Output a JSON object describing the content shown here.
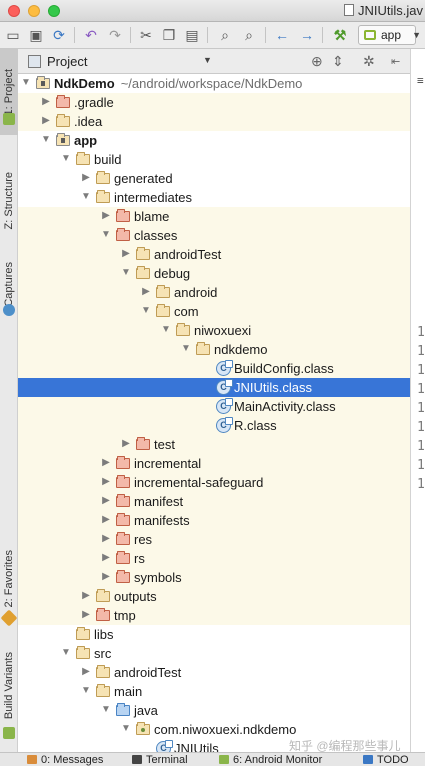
{
  "window": {
    "title": "JNIUtils.jav",
    "run_config": "app"
  },
  "toolbar_icons": [
    "open-folder-icon",
    "save-icon",
    "sync-icon",
    "undo-icon",
    "redo-icon",
    "cut-icon",
    "copy-icon",
    "paste-icon",
    "find-icon",
    "replace-icon",
    "back-icon",
    "forward-icon",
    "build-hammer-icon"
  ],
  "left_tabs": {
    "project": "1: Project",
    "structure": "Z: Structure",
    "captures": "Captures",
    "favorites": "2: Favorites",
    "build_variants": "Build Variants"
  },
  "panel": {
    "view_label": "Project"
  },
  "tree": [
    {
      "label": "NdkDemo",
      "path": "~/android/workspace/NdkDemo",
      "depth": 0,
      "arrow": "expanded",
      "icon": "module",
      "bold": true,
      "band": false
    },
    {
      "label": ".gradle",
      "depth": 1,
      "arrow": "collapsed",
      "icon": "excluded",
      "band": true
    },
    {
      "label": ".idea",
      "depth": 1,
      "arrow": "collapsed",
      "icon": "plain",
      "band": true
    },
    {
      "label": "app",
      "depth": 1,
      "arrow": "expanded",
      "icon": "module",
      "bold": true,
      "band": false
    },
    {
      "label": "build",
      "depth": 2,
      "arrow": "expanded",
      "icon": "plain",
      "band": false
    },
    {
      "label": "generated",
      "depth": 3,
      "arrow": "collapsed",
      "icon": "plain",
      "band": false
    },
    {
      "label": "intermediates",
      "depth": 3,
      "arrow": "expanded",
      "icon": "plain",
      "band": false
    },
    {
      "label": "blame",
      "depth": 4,
      "arrow": "collapsed",
      "icon": "excluded",
      "band": true
    },
    {
      "label": "classes",
      "depth": 4,
      "arrow": "expanded",
      "icon": "excluded",
      "band": true
    },
    {
      "label": "androidTest",
      "depth": 5,
      "arrow": "collapsed",
      "icon": "plain",
      "band": true
    },
    {
      "label": "debug",
      "depth": 5,
      "arrow": "expanded",
      "icon": "plain",
      "band": true
    },
    {
      "label": "android",
      "depth": 6,
      "arrow": "collapsed",
      "icon": "plain",
      "band": true
    },
    {
      "label": "com",
      "depth": 6,
      "arrow": "expanded",
      "icon": "plain",
      "band": true
    },
    {
      "label": "niwoxuexi",
      "depth": 7,
      "arrow": "expanded",
      "icon": "plain",
      "band": true
    },
    {
      "label": "ndkdemo",
      "depth": 8,
      "arrow": "expanded",
      "icon": "plain",
      "band": true
    },
    {
      "label": "BuildConfig.class",
      "depth": 9,
      "arrow": "none",
      "icon": "class",
      "band": true
    },
    {
      "label": "JNIUtils.class",
      "depth": 9,
      "arrow": "none",
      "icon": "class",
      "selected": true
    },
    {
      "label": "MainActivity.class",
      "depth": 9,
      "arrow": "none",
      "icon": "class",
      "band": true
    },
    {
      "label": "R.class",
      "depth": 9,
      "arrow": "none",
      "icon": "class",
      "band": true
    },
    {
      "label": "test",
      "depth": 5,
      "arrow": "collapsed",
      "icon": "excluded",
      "band": true
    },
    {
      "label": "incremental",
      "depth": 4,
      "arrow": "collapsed",
      "icon": "excluded",
      "band": true
    },
    {
      "label": "incremental-safeguard",
      "depth": 4,
      "arrow": "collapsed",
      "icon": "excluded",
      "band": true
    },
    {
      "label": "manifest",
      "depth": 4,
      "arrow": "collapsed",
      "icon": "excluded",
      "band": true
    },
    {
      "label": "manifests",
      "depth": 4,
      "arrow": "collapsed",
      "icon": "excluded",
      "band": true
    },
    {
      "label": "res",
      "depth": 4,
      "arrow": "collapsed",
      "icon": "excluded",
      "band": true
    },
    {
      "label": "rs",
      "depth": 4,
      "arrow": "collapsed",
      "icon": "excluded",
      "band": true
    },
    {
      "label": "symbols",
      "depth": 4,
      "arrow": "collapsed",
      "icon": "excluded",
      "band": true
    },
    {
      "label": "outputs",
      "depth": 3,
      "arrow": "collapsed",
      "icon": "plain",
      "band": true
    },
    {
      "label": "tmp",
      "depth": 3,
      "arrow": "collapsed",
      "icon": "excluded",
      "band": true
    },
    {
      "label": "libs",
      "depth": 2,
      "arrow": "none",
      "icon": "plain",
      "band": false
    },
    {
      "label": "src",
      "depth": 2,
      "arrow": "expanded",
      "icon": "plain",
      "band": false
    },
    {
      "label": "androidTest",
      "depth": 3,
      "arrow": "collapsed",
      "icon": "plain",
      "band": false
    },
    {
      "label": "main",
      "depth": 3,
      "arrow": "expanded",
      "icon": "plain",
      "band": false
    },
    {
      "label": "java",
      "depth": 4,
      "arrow": "expanded",
      "icon": "source",
      "band": false
    },
    {
      "label": "com.niwoxuexi.ndkdemo",
      "depth": 5,
      "arrow": "expanded",
      "icon": "package",
      "band": false
    },
    {
      "label": "JNIUtils",
      "depth": 6,
      "arrow": "none",
      "icon": "class",
      "band": false
    }
  ],
  "line_numbers": [
    "1",
    "1",
    "1",
    "1",
    "1",
    "1",
    "1",
    "1",
    "1"
  ],
  "bottom_tabs": {
    "messages": "0: Messages",
    "terminal": "Terminal",
    "monitor": "6: Android Monitor",
    "todo": "TODO"
  },
  "watermark": "知乎 @编程那些事儿",
  "colors": {
    "selection": "#3875d7",
    "band": "#fcf9e8",
    "folder": "#f6e3b4",
    "excluded_folder": "#f3b9a9",
    "source_folder": "#b8d4f2"
  }
}
